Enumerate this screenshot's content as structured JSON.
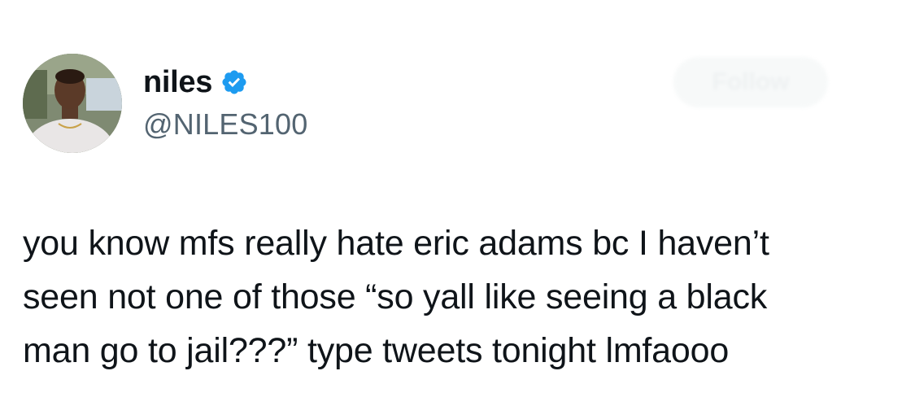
{
  "author": {
    "display_name": "niles",
    "handle": "@NILES100",
    "verified": true,
    "verified_icon": "verified-badge-icon",
    "verified_color": "#1d9bf0"
  },
  "follow_button": {
    "label": "Follow"
  },
  "tweet": {
    "lines": [
      "you know mfs really hate eric adams bc I haven’t",
      "seen not one of those “so yall like seeing a black",
      "man go to jail???” type tweets tonight lmfaooo"
    ]
  },
  "colors": {
    "text_primary": "#0f1419",
    "text_secondary": "#536471",
    "background": "#ffffff"
  }
}
